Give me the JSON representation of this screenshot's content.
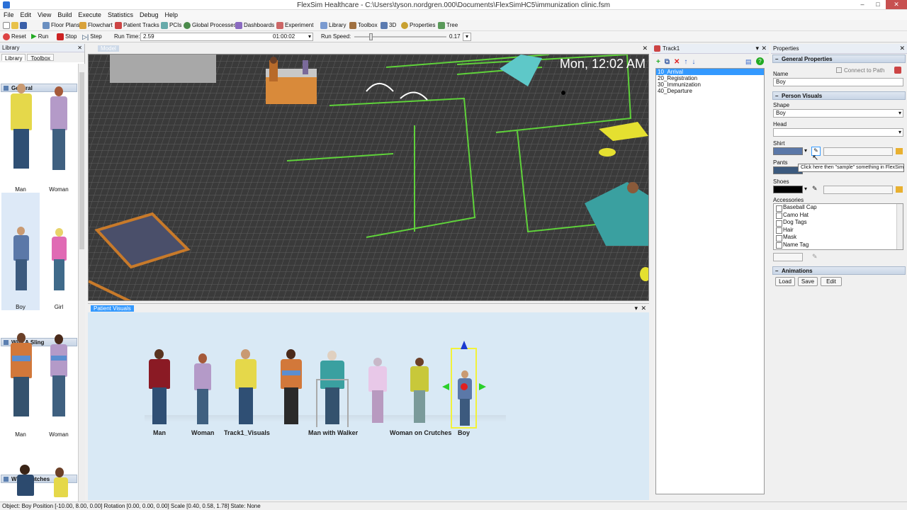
{
  "window": {
    "title": "FlexSim Healthcare - C:\\Users\\tyson.nordgren.000\\Documents\\FlexSimHC5\\immunization clinic.fsm",
    "minimize": "–",
    "maximize": "□",
    "close": "✕"
  },
  "menu": [
    "File",
    "Edit",
    "View",
    "Build",
    "Execute",
    "Statistics",
    "Debug",
    "Help"
  ],
  "toolbar": {
    "floor_plans": "Floor Plans",
    "flowchart": "Flowchart",
    "patient_tracks": "Patient Tracks",
    "pcis": "PCIs",
    "global_processes": "Global Processes",
    "dashboards": "Dashboards",
    "experiment": "Experiment",
    "library": "Library",
    "toolbox": "Toolbox",
    "three_d": "3D",
    "properties": "Properties",
    "tree": "Tree"
  },
  "runbar": {
    "reset": "Reset",
    "run": "Run",
    "stop": "Stop",
    "step": "Step",
    "run_time_label": "Run Time:",
    "run_time_value": "2.59",
    "clock": "01:00:02",
    "run_speed_label": "Run Speed:",
    "run_speed_value": "0.17",
    "run_speed_fraction": 0.17
  },
  "library": {
    "title": "Library",
    "close": "✕",
    "tabs": [
      "Library",
      "Toolbox"
    ],
    "sections": [
      {
        "name": "General",
        "items": [
          "Man",
          "Woman",
          "Boy",
          "Girl"
        ]
      },
      {
        "name": "With A Sling",
        "items": [
          "Man",
          "Woman"
        ]
      },
      {
        "name": "With Crutches",
        "items": []
      }
    ]
  },
  "view3d": {
    "tab": "Model",
    "clock": "Mon, 12:02 AM"
  },
  "patient_visuals": {
    "title": "Patient Visuals",
    "close": "✕",
    "pin": "▾",
    "labels": [
      "Man",
      "Woman",
      "Track1_Visuals",
      "Man with Walker",
      "Woman on Crutches",
      "Boy"
    ]
  },
  "track": {
    "title": "Track1",
    "close": "✕",
    "pin": "▾",
    "items": [
      "10_Arrival",
      "20_Registration",
      "30_Immunization",
      "40_Departure"
    ]
  },
  "properties": {
    "title": "Properties",
    "close": "✕",
    "general_title": "General Properties",
    "connect_to_path": "Connect to Path",
    "name_label": "Name",
    "name_value": "Boy",
    "visuals_title": "Person Visuals",
    "shape_label": "Shape",
    "shape_value": "Boy",
    "head_label": "Head",
    "head_value": "",
    "shirt_label": "Shirt",
    "pants_label": "Pants",
    "shoes_label": "Shoes",
    "shirt_color": "#5b78a8",
    "pants_color": "#3c5a7e",
    "shoes_color": "#000000",
    "tooltip": "Click here then \"sample\" something in FlexSim",
    "accessories_label": "Accessories",
    "accessories": [
      "Baseball Cap",
      "Camo Hat",
      "Dog Tags",
      "Hair",
      "Mask",
      "Name Tag"
    ],
    "animations_title": "Animations",
    "load": "Load",
    "save": "Save",
    "edit": "Edit"
  },
  "status": "Object: Boy Position [-10.00, 8.00, 0.00] Rotation [0.00, 0.00, 0.00] Scale [0.40, 0.58, 1.78] State: None"
}
